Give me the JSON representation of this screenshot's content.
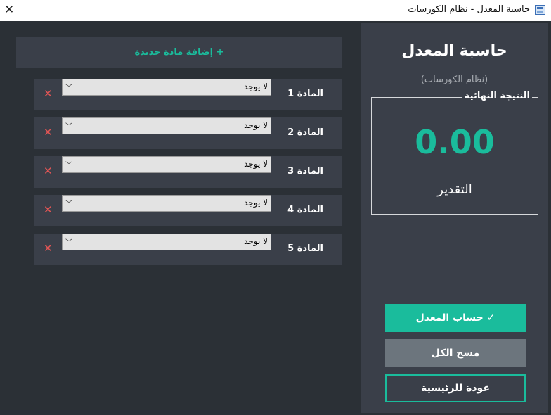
{
  "window": {
    "title": "حاسبة المعدل - نظام الكورسات"
  },
  "sidebar": {
    "title": "حاسبة المعدل",
    "subtitle": "(نظام الكورسات)",
    "result": {
      "legend": "النتيجة النهائية",
      "value": "0.00",
      "grade_label": "التقدير"
    },
    "buttons": {
      "calculate": "✓ حساب المعدل",
      "clear_all": "مسح الكل",
      "back_home": "عودة للرئيسية"
    }
  },
  "main": {
    "add_subject": "+ إضافة مادة جديدة",
    "subjects": [
      {
        "label": "المادة 1",
        "grade": "لا يوجد"
      },
      {
        "label": "المادة 2",
        "grade": "لا يوجد"
      },
      {
        "label": "المادة 3",
        "grade": "لا يوجد"
      },
      {
        "label": "المادة 4",
        "grade": "لا يوجد"
      },
      {
        "label": "المادة 5",
        "grade": "لا يوجد"
      }
    ]
  },
  "icons": {
    "close": "close-icon",
    "app": "calculator-app-icon",
    "remove": "remove-icon",
    "dropdown": "chevron-down-icon"
  },
  "colors": {
    "accent": "#1abc9c",
    "background": "#2b3036",
    "panel": "#3a3f49",
    "danger": "#e05555",
    "secondary": "#6c757d"
  }
}
